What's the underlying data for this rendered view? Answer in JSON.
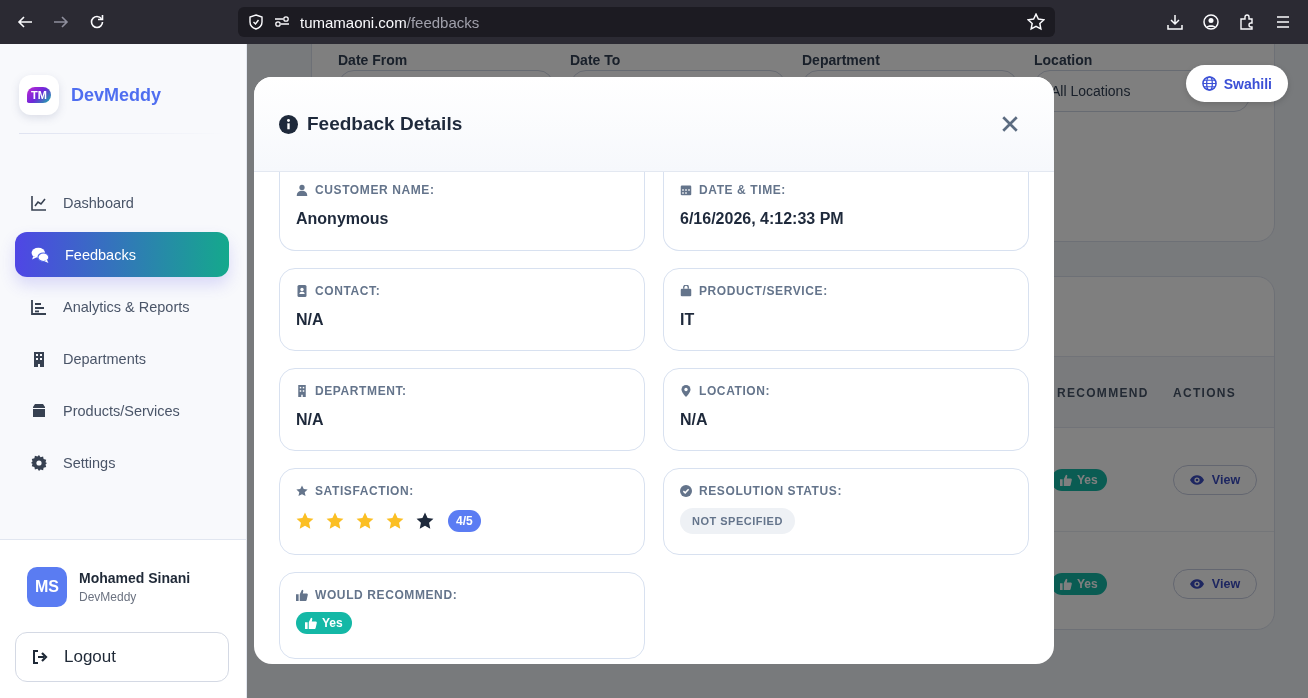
{
  "browser": {
    "url_host": "tumamaoni.com",
    "url_path": "/feedbacks",
    "forward_disabled": true
  },
  "sidebar": {
    "logo_text": "TM",
    "brand": "DevMeddy",
    "items": [
      {
        "label": "Dashboard",
        "selected": false
      },
      {
        "label": "Feedbacks",
        "selected": true
      },
      {
        "label": "Analytics & Reports",
        "selected": false
      },
      {
        "label": "Departments",
        "selected": false
      },
      {
        "label": "Products/Services",
        "selected": false
      },
      {
        "label": "Settings",
        "selected": false
      }
    ],
    "user": {
      "initials": "MS",
      "name": "Mohamed Sinani",
      "org": "DevMeddy"
    },
    "logout": "Logout"
  },
  "filters": [
    {
      "label": "Date From"
    },
    {
      "label": "Date To"
    },
    {
      "label": "Department"
    },
    {
      "label": "Location",
      "value": "All Locations"
    }
  ],
  "table": {
    "columns": [
      "RECOMMEND",
      "ACTIONS"
    ],
    "rows": [
      {
        "recommend": "Yes",
        "action": "View"
      },
      {
        "recommend": "Yes",
        "action": "View"
      }
    ]
  },
  "language_button": "Swahili",
  "modal": {
    "title": "Feedback Details",
    "fields": [
      {
        "kind": "text",
        "label": "CUSTOMER NAME:",
        "value": "Anonymous"
      },
      {
        "kind": "text",
        "label": "DATE & TIME:",
        "value": "6/16/2026, 4:12:33 PM"
      },
      {
        "kind": "text",
        "label": "CONTACT:",
        "value": "N/A"
      },
      {
        "kind": "text",
        "label": "PRODUCT/SERVICE:",
        "value": "IT"
      },
      {
        "kind": "text",
        "label": "DEPARTMENT:",
        "value": "N/A"
      },
      {
        "kind": "text",
        "label": "LOCATION:",
        "value": "N/A"
      },
      {
        "kind": "rating",
        "label": "SATISFACTION:",
        "stars": 4,
        "value": "4/5"
      },
      {
        "kind": "status",
        "label": "RESOLUTION STATUS:",
        "value": "NOT SPECIFIED"
      },
      {
        "kind": "recommend",
        "label": "WOULD RECOMMEND:",
        "value": "Yes"
      }
    ]
  }
}
